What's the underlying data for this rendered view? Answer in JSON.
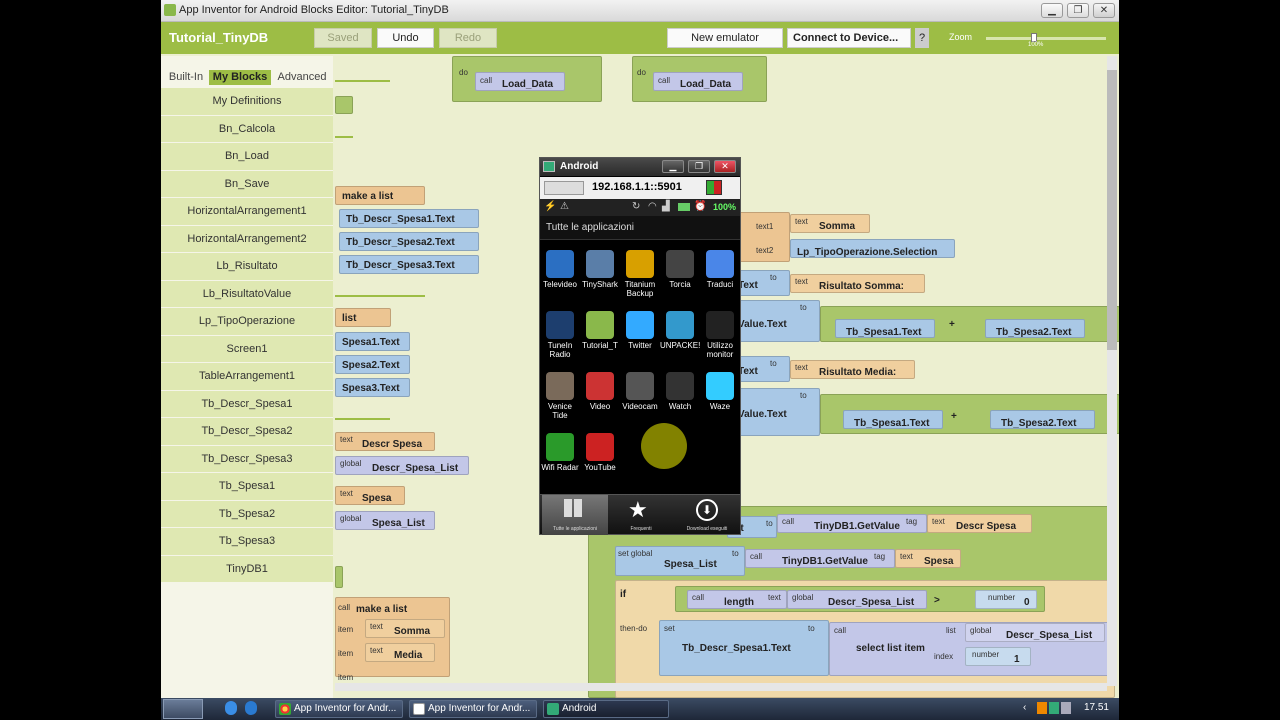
{
  "window": {
    "title": "App Inventor for Android Blocks Editor: Tutorial_TinyDB",
    "minimize": "▁",
    "maximize": "❐",
    "close": "✕"
  },
  "toolbar": {
    "app_name": "Tutorial_TinyDB",
    "saved": "Saved",
    "undo": "Undo",
    "redo": "Redo",
    "new_emulator": "New emulator",
    "connect": "Connect to Device...",
    "help": "?",
    "zoom_label": "Zoom",
    "zoom_value": "100%"
  },
  "sidebar": {
    "tabs": [
      "Built-In",
      "My Blocks",
      "Advanced"
    ],
    "active_tab": "My Blocks",
    "drawers": [
      "My Definitions",
      "Bn_Calcola",
      "Bn_Load",
      "Bn_Save",
      "HorizontalArrangement1",
      "HorizontalArrangement2",
      "Lb_Risultato",
      "Lb_RisultatoValue",
      "Lp_TipoOperazione",
      "Screen1",
      "TableArrangement1",
      "Tb_Descr_Spesa1",
      "Tb_Descr_Spesa2",
      "Tb_Descr_Spesa3",
      "Tb_Spesa1",
      "Tb_Spesa2",
      "Tb_Spesa3",
      "TinyDB1"
    ]
  },
  "blocks": {
    "call_load_1": "Load_Data",
    "call_load_2": "Load_Data",
    "kw_do": "do",
    "kw_call": "call",
    "make_list_1": "make a list",
    "tb_descr1": "Tb_Descr_Spesa1.Text",
    "tb_descr2": "Tb_Descr_Spesa2.Text",
    "tb_descr3": "Tb_Descr_Spesa3.Text",
    "list_label": "list",
    "spesa1": "Spesa1.Text",
    "spesa2": "Spesa2.Text",
    "spesa3": "Spesa3.Text",
    "text_kw": "text",
    "global_kw": "global",
    "descr_spesa_text": "Descr Spesa",
    "descr_spesa_list": "Descr_Spesa_List",
    "spesa_text": "Spesa",
    "spesa_list": "Spesa_List",
    "make_list_2": "make a list",
    "item_kw": "item",
    "somma_text": "Somma",
    "media_text": "Media",
    "text1_kw": "text1",
    "text2_kw": "text2",
    "somma_right": "Somma",
    "lp_selection": "Lp_TipoOperazione.Selection",
    "to_kw": "to",
    "text_right_1": "Text",
    "risultato_somma": "Risultato Somma:",
    "value_text_1": "Value.Text",
    "tb_spesa1_a": "Tb_Spesa1.Text",
    "plus": "+",
    "tb_spesa2_a": "Tb_Spesa2.Text",
    "text_right_2": "Text",
    "risultato_media": "Risultato Media:",
    "value_text_2": "Value.Text",
    "tb_spesa1_b": "Tb_Spesa1.Text",
    "tb_spesa2_b": "Tb_Spesa2.Text",
    "list_right": "ist",
    "tinydb_get_1": "TinyDB1.GetValue",
    "tag_kw": "tag",
    "descr_spesa_tag": "Descr Spesa",
    "set_global_kw": "set global",
    "spesa_list_set": "Spesa_List",
    "tinydb_get_2": "TinyDB1.GetValue",
    "spesa_tag": "Spesa",
    "if_kw": "if",
    "length_kw": "length",
    "descr_spesa_list_2": "Descr_Spesa_List",
    "gt": ">",
    "number_kw": "number",
    "zero": "0",
    "then_do_kw": "then-do",
    "set_kw": "set",
    "tb_descr1_set": "Tb_Descr_Spesa1.Text",
    "select_list_item": "select list item",
    "list_kw": "list",
    "index_kw": "index",
    "descr_list_3": "Descr_Spesa_List",
    "one": "1"
  },
  "emulator": {
    "title": "Android",
    "address": "192.168.1.1::5901",
    "battery": "100%",
    "header": "Tutte le applicazioni",
    "apps": [
      {
        "name": "Televideo",
        "color": "#2b6fc2"
      },
      {
        "name": "TinyShark",
        "color": "#5a7ea8"
      },
      {
        "name": "Titanium Backup",
        "color": "#d8a000"
      },
      {
        "name": "Torcia",
        "color": "#444444"
      },
      {
        "name": "Traduci",
        "color": "#4a86e8"
      },
      {
        "name": "TuneIn Radio",
        "color": "#1d3e6e"
      },
      {
        "name": "Tutorial_T",
        "color": "#8ab84b"
      },
      {
        "name": "Twitter",
        "color": "#33aaff"
      },
      {
        "name": "UNPACKE!",
        "color": "#3399cc"
      },
      {
        "name": "Utilizzo monitor",
        "color": "#222222"
      },
      {
        "name": "Venice Tide",
        "color": "#7a6a5a"
      },
      {
        "name": "Video",
        "color": "#cc3333"
      },
      {
        "name": "Videocam",
        "color": "#555555"
      },
      {
        "name": "Watch",
        "color": "#333333"
      },
      {
        "name": "Waze",
        "color": "#33ccff"
      },
      {
        "name": "Wifi Radar",
        "color": "#2a9a2a"
      },
      {
        "name": "YouTube",
        "color": "#cc2222"
      }
    ],
    "dock": [
      "Tutte le applicazioni",
      "Frequenti",
      "Download eseguiti"
    ]
  },
  "taskbar": {
    "tasks": [
      "App Inventor for Andr...",
      "App Inventor for Andr...",
      "Android"
    ],
    "clock": "17.51"
  }
}
